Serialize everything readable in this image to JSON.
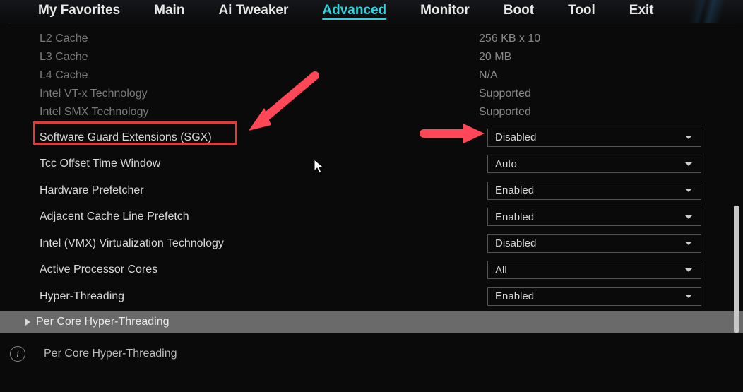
{
  "nav": {
    "items": [
      {
        "label": "My Favorites"
      },
      {
        "label": "Main"
      },
      {
        "label": "Ai Tweaker"
      },
      {
        "label": "Advanced",
        "active": true
      },
      {
        "label": "Monitor"
      },
      {
        "label": "Boot"
      },
      {
        "label": "Tool"
      },
      {
        "label": "Exit"
      }
    ]
  },
  "info": [
    {
      "label": "L2 Cache",
      "value": "256 KB x 10"
    },
    {
      "label": "L3 Cache",
      "value": "20 MB"
    },
    {
      "label": "L4 Cache",
      "value": "N/A"
    },
    {
      "label": "Intel VT-x Technology",
      "value": "Supported"
    },
    {
      "label": "Intel SMX Technology",
      "value": "Supported"
    }
  ],
  "settings": [
    {
      "label": "Software Guard Extensions (SGX)",
      "value": "Disabled"
    },
    {
      "label": "Tcc Offset Time Window",
      "value": "Auto"
    },
    {
      "label": "Hardware Prefetcher",
      "value": "Enabled"
    },
    {
      "label": "Adjacent Cache Line Prefetch",
      "value": "Enabled"
    },
    {
      "label": "Intel (VMX) Virtualization Technology",
      "value": "Disabled"
    },
    {
      "label": "Active Processor Cores",
      "value": "All"
    },
    {
      "label": "Hyper-Threading",
      "value": "Enabled"
    }
  ],
  "submenu": {
    "label": "Per Core Hyper-Threading"
  },
  "help": {
    "text": "Per Core Hyper-Threading"
  },
  "annotations": {
    "highlight_color": "#e03a3a",
    "arrow_color": "#ff4757"
  }
}
